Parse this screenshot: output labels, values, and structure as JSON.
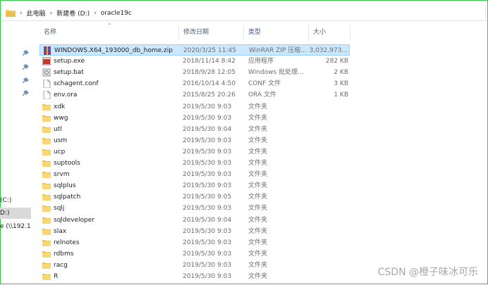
{
  "address_bar": {
    "breadcrumbs": [
      "此电脑",
      "新建卷 (D:)",
      "oracle19c"
    ]
  },
  "columns": {
    "name": "名称",
    "date": "修改日期",
    "type": "类型",
    "size": "大小"
  },
  "nav_pane": {
    "items": [
      "(C:)",
      "D:)",
      "e (\\\\192.1"
    ]
  },
  "files": [
    {
      "name": "WINDOWS.X64_193000_db_home.zip",
      "date": "2020/3/25 11:45",
      "type": "WinRAR ZIP 压缩...",
      "size": "3,032,973...",
      "icon": "winrar-zip-icon",
      "selected": true
    },
    {
      "name": "setup.exe",
      "date": "2018/11/14 8:42",
      "type": "应用程序",
      "size": "282 KB",
      "icon": "exe-icon"
    },
    {
      "name": "setup.bat",
      "date": "2018/9/28 12:05",
      "type": "Windows 批处理...",
      "size": "2 KB",
      "icon": "bat-icon"
    },
    {
      "name": "schagent.conf",
      "date": "2016/10/14 4:50",
      "type": "CONF 文件",
      "size": "3 KB",
      "icon": "file-icon"
    },
    {
      "name": "env.ora",
      "date": "2015/8/25 20:26",
      "type": "ORA 文件",
      "size": "1 KB",
      "icon": "file-icon"
    },
    {
      "name": "xdk",
      "date": "2019/5/30 9:03",
      "type": "文件夹",
      "size": "",
      "icon": "folder-icon"
    },
    {
      "name": "wwg",
      "date": "2019/5/30 9:03",
      "type": "文件夹",
      "size": "",
      "icon": "folder-icon"
    },
    {
      "name": "utl",
      "date": "2019/5/30 9:04",
      "type": "文件夹",
      "size": "",
      "icon": "folder-icon"
    },
    {
      "name": "usm",
      "date": "2019/5/30 9:03",
      "type": "文件夹",
      "size": "",
      "icon": "folder-icon"
    },
    {
      "name": "ucp",
      "date": "2019/5/30 9:03",
      "type": "文件夹",
      "size": "",
      "icon": "folder-icon"
    },
    {
      "name": "suptools",
      "date": "2019/5/30 9:03",
      "type": "文件夹",
      "size": "",
      "icon": "folder-icon"
    },
    {
      "name": "srvm",
      "date": "2019/5/30 9:03",
      "type": "文件夹",
      "size": "",
      "icon": "folder-icon"
    },
    {
      "name": "sqlplus",
      "date": "2019/5/30 9:03",
      "type": "文件夹",
      "size": "",
      "icon": "folder-icon"
    },
    {
      "name": "sqlpatch",
      "date": "2019/5/30 9:05",
      "type": "文件夹",
      "size": "",
      "icon": "folder-icon"
    },
    {
      "name": "sqlj",
      "date": "2019/5/30 9:03",
      "type": "文件夹",
      "size": "",
      "icon": "folder-icon"
    },
    {
      "name": "sqldeveloper",
      "date": "2019/5/30 9:04",
      "type": "文件夹",
      "size": "",
      "icon": "folder-icon"
    },
    {
      "name": "slax",
      "date": "2019/5/30 9:03",
      "type": "文件夹",
      "size": "",
      "icon": "folder-icon"
    },
    {
      "name": "relnotes",
      "date": "2019/5/30 9:03",
      "type": "文件夹",
      "size": "",
      "icon": "folder-icon"
    },
    {
      "name": "rdbms",
      "date": "2019/5/30 9:03",
      "type": "文件夹",
      "size": "",
      "icon": "folder-icon"
    },
    {
      "name": "racg",
      "date": "2019/5/30 9:03",
      "type": "文件夹",
      "size": "",
      "icon": "folder-icon"
    },
    {
      "name": "R",
      "date": "2019/5/30 9:03",
      "type": "文件夹",
      "size": "",
      "icon": "folder-icon"
    }
  ],
  "watermark": "CSDN @橙子味冰可乐",
  "colors": {
    "selection_bg": "#cce8ff",
    "selection_border": "#99d1ff",
    "folder": "#f8d775",
    "frame": "#2ecc40"
  }
}
